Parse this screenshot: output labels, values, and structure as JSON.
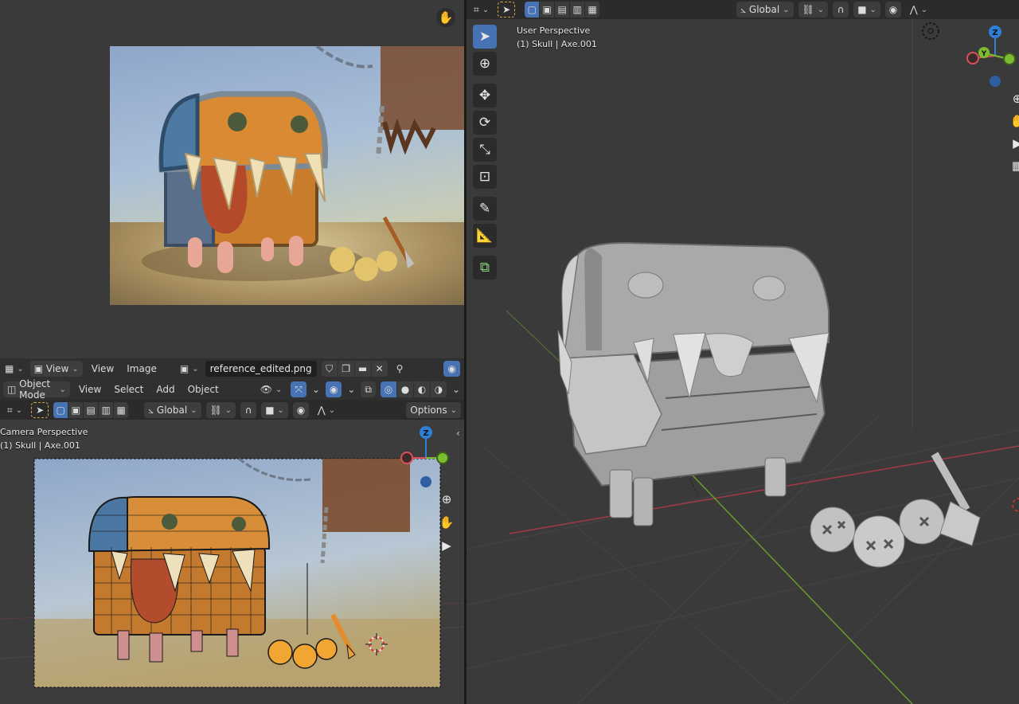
{
  "image_editor": {
    "header": {
      "view_menu_1": "View",
      "view_menu_2": "View",
      "image_menu": "Image",
      "image_name": "reference_edited.png"
    }
  },
  "viewport_left": {
    "header": {
      "mode": "Object Mode",
      "menus": [
        "View",
        "Select",
        "Add",
        "Object"
      ]
    },
    "tool_header": {
      "orientation": "Global",
      "options_label": "Options"
    },
    "overlay": {
      "line1": "Camera Perspective",
      "line2": "(1) Skull | Axe.001"
    },
    "gizmo": {
      "z_label": "Z"
    }
  },
  "viewport_right": {
    "tool_header": {
      "orientation": "Global"
    },
    "overlay": {
      "line1": "User Perspective",
      "line2": "(1) Skull | Axe.001"
    },
    "gizmo": {
      "z_label": "Z",
      "y_label": "Y"
    }
  },
  "colors": {
    "active_blue": "#4772b3",
    "axis_x": "#e04e5d",
    "axis_y": "#7bbd31",
    "axis_z": "#2e7fd8"
  },
  "icons": [
    "cursor-icon",
    "crosshair-icon",
    "move-icon",
    "rotate-icon",
    "scale-icon",
    "transform-icon",
    "annotate-icon",
    "measure-icon",
    "add-cube-icon",
    "zoom-icon",
    "hand-icon",
    "camera-icon",
    "grid-icon"
  ]
}
